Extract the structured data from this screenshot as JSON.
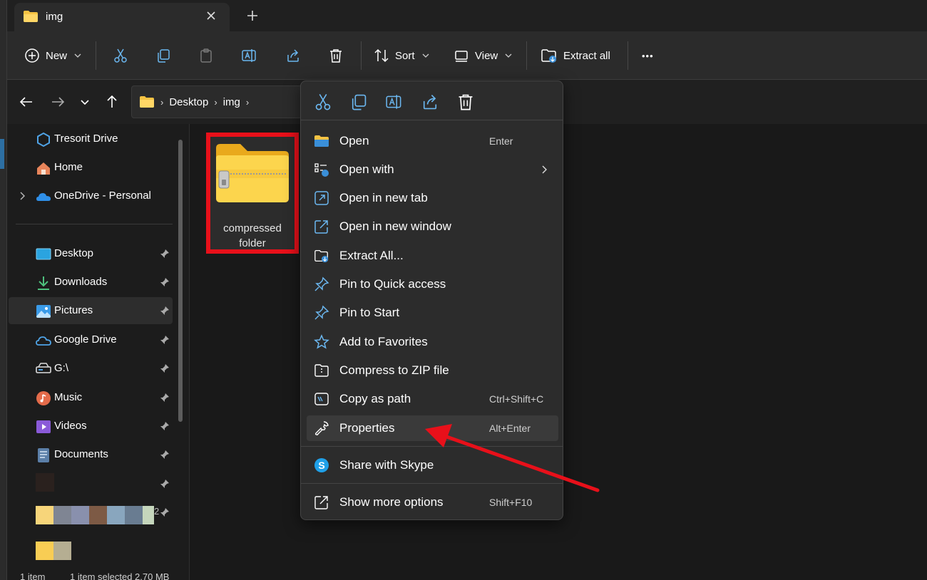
{
  "window": {
    "tab_title": "img",
    "new_tab_glyph": "+"
  },
  "toolbar": {
    "new_label": "New",
    "sort_label": "Sort",
    "view_label": "View",
    "extract_all_label": "Extract all",
    "more_glyph": "•••",
    "icons": [
      "cut-icon",
      "copy-icon",
      "paste-icon",
      "rename-icon",
      "share-icon",
      "delete-icon"
    ]
  },
  "address": {
    "breadcrumbs": [
      "Desktop",
      "img"
    ],
    "separator": "›"
  },
  "sidebar": {
    "items": [
      {
        "label": "Tresorit Drive",
        "icon": "tresorit-icon"
      },
      {
        "label": "Home",
        "icon": "home-icon"
      },
      {
        "label": "OneDrive - Personal",
        "icon": "onedrive-icon"
      },
      {
        "label": "Desktop",
        "icon": "desktop-icon",
        "pinned": true
      },
      {
        "label": "Downloads",
        "icon": "downloads-icon",
        "pinned": true
      },
      {
        "label": "Pictures",
        "icon": "pictures-icon",
        "pinned": true,
        "selected": true
      },
      {
        "label": "Google Drive",
        "icon": "google-drive-icon",
        "pinned": true
      },
      {
        "label": "G:\\",
        "icon": "drive-icon",
        "pinned": true
      },
      {
        "label": "Music",
        "icon": "music-icon",
        "pinned": true
      },
      {
        "label": "Videos",
        "icon": "videos-icon",
        "pinned": true
      },
      {
        "label": "Documents",
        "icon": "documents-icon",
        "pinned": true
      }
    ],
    "blurred_fragment": "2"
  },
  "content": {
    "file_label_line1": "compressed",
    "file_label_line2": "folder",
    "highlight_color": "#e8101a"
  },
  "status": {
    "item_count": "1 item",
    "selected": "1 item selected  2.70 MB"
  },
  "context_menu": {
    "quick_actions": [
      "cut-icon",
      "copy-icon",
      "rename-icon",
      "share-icon",
      "delete-icon"
    ],
    "items": [
      {
        "label": "Open",
        "shortcut": "Enter"
      },
      {
        "label": "Open with",
        "submenu": true
      },
      {
        "label": "Open in new tab"
      },
      {
        "label": "Open in new window"
      },
      {
        "label": "Extract All..."
      },
      {
        "label": "Pin to Quick access"
      },
      {
        "label": "Pin to Start"
      },
      {
        "label": "Add to Favorites"
      },
      {
        "label": "Compress to ZIP file"
      },
      {
        "label": "Copy as path",
        "shortcut": "Ctrl+Shift+C"
      },
      {
        "label": "Properties",
        "shortcut": "Alt+Enter",
        "highlighted": true
      },
      {
        "label": "Share with Skype"
      },
      {
        "label": "Show more options",
        "shortcut": "Shift+F10"
      }
    ]
  },
  "annotation": {
    "arrow_color": "#e8101a"
  }
}
